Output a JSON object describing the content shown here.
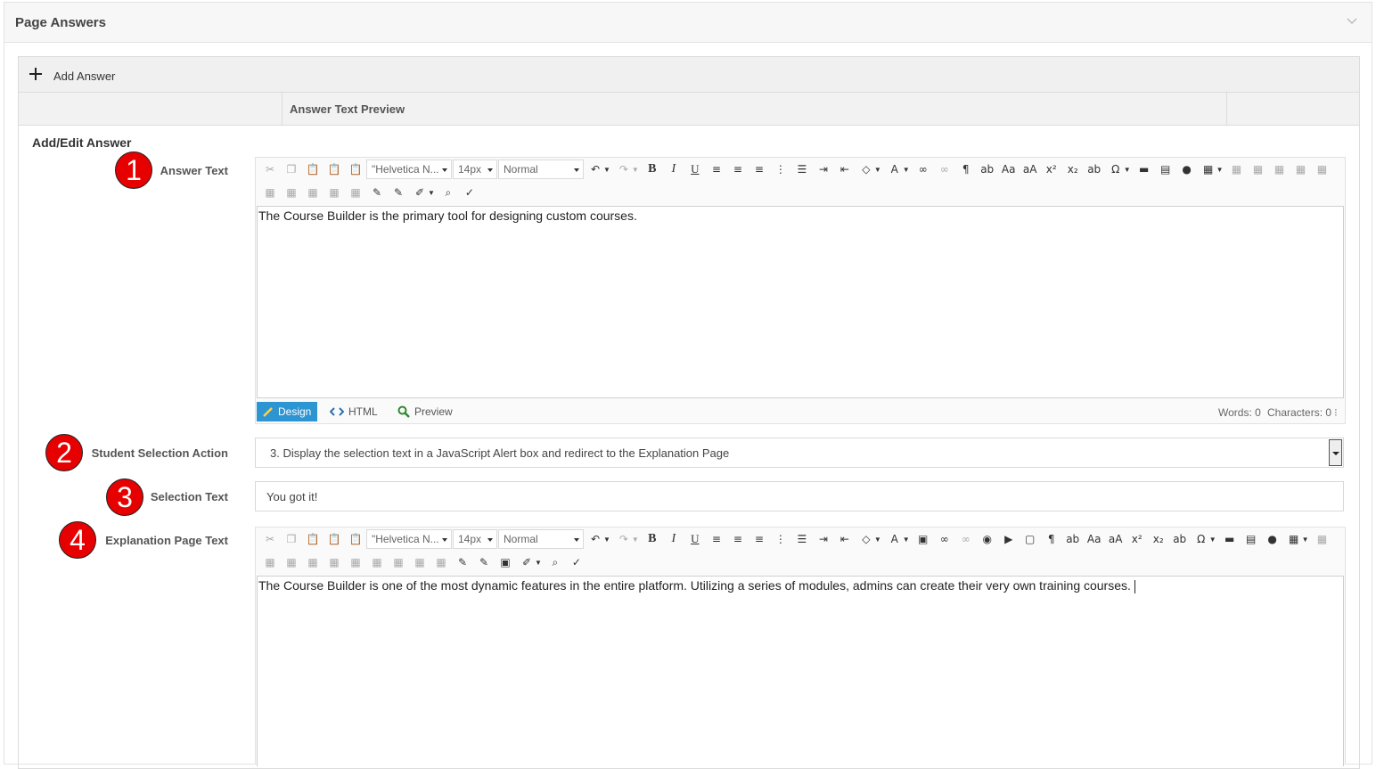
{
  "panel": {
    "title": "Page Answers",
    "collapse_icon": "chevron-down-icon"
  },
  "add_answer": {
    "label": "Add Answer",
    "icon": "plus-icon"
  },
  "table": {
    "column_preview": "Answer Text Preview"
  },
  "form": {
    "section_title": "Add/Edit Answer",
    "answer_text": {
      "badge": "1",
      "label": "Answer Text",
      "font_family": "\"Helvetica N...",
      "font_size": "14px",
      "format": "Normal",
      "content": "The Course Builder is the primary tool for designing custom courses."
    },
    "selection_action": {
      "badge": "2",
      "label": "Student Selection Action",
      "value": "3. Display the selection text in a JavaScript Alert box and redirect to the Explanation Page"
    },
    "selection_text": {
      "badge": "3",
      "label": "Selection Text",
      "value": "You got it!"
    },
    "explanation": {
      "badge": "4",
      "label": "Explanation Page Text",
      "font_family": "\"Helvetica N...",
      "font_size": "14px",
      "format": "Normal",
      "content": "The Course Builder is one of the most dynamic features in the entire platform. Utilizing a series of modules, admins can create their very own training courses."
    }
  },
  "editor_modes": {
    "design": "Design",
    "html": "HTML",
    "preview": "Preview"
  },
  "counters": {
    "words": "Words: 0",
    "characters": "Characters: 0"
  },
  "colors": {
    "badge": "#e60000",
    "active_tab": "#2e95d3"
  }
}
